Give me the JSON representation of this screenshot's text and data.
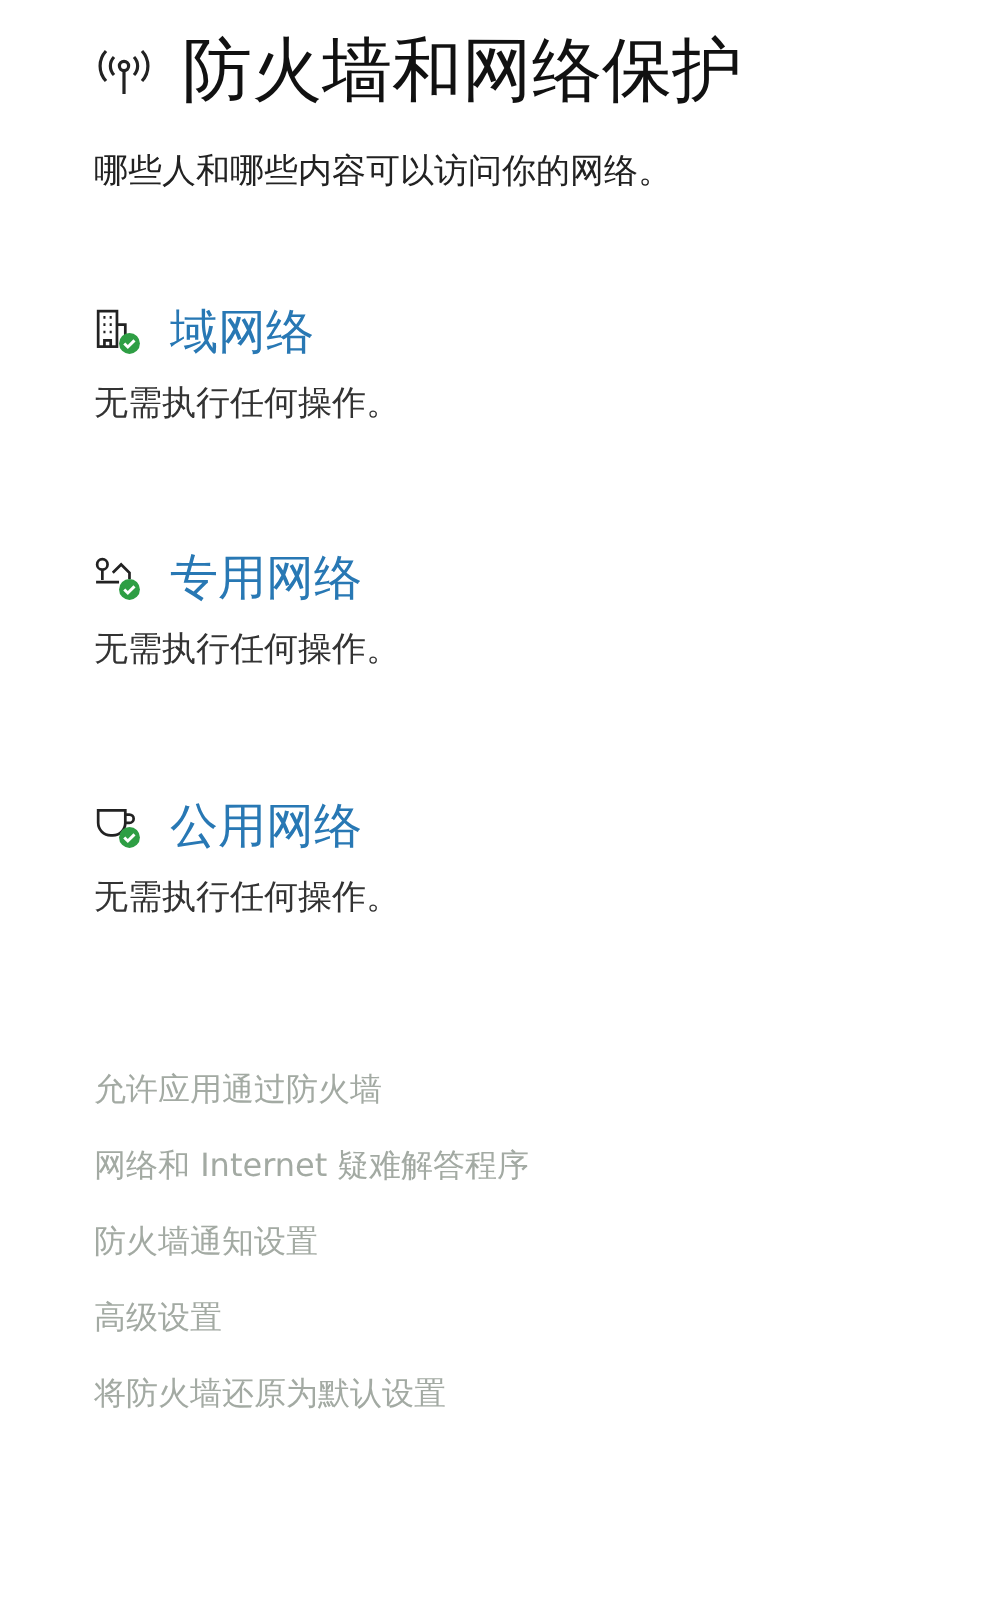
{
  "page": {
    "title": "防火墙和网络保护",
    "subtitle": "哪些人和哪些内容可以访问你的网络。"
  },
  "networks": [
    {
      "kind": "domain",
      "name": "域网络",
      "status": "无需执行任何操作。"
    },
    {
      "kind": "private",
      "name": "专用网络",
      "status": "无需执行任何操作。"
    },
    {
      "kind": "public",
      "name": "公用网络",
      "status": "无需执行任何操作。"
    }
  ],
  "links": [
    {
      "label": "允许应用通过防火墙",
      "disabled": true
    },
    {
      "label": "网络和 Internet 疑难解答程序",
      "disabled": true
    },
    {
      "label": "防火墙通知设置",
      "disabled": true
    },
    {
      "label": "高级设置",
      "disabled": true
    },
    {
      "label": "将防火墙还原为默认设置",
      "disabled": true
    }
  ]
}
